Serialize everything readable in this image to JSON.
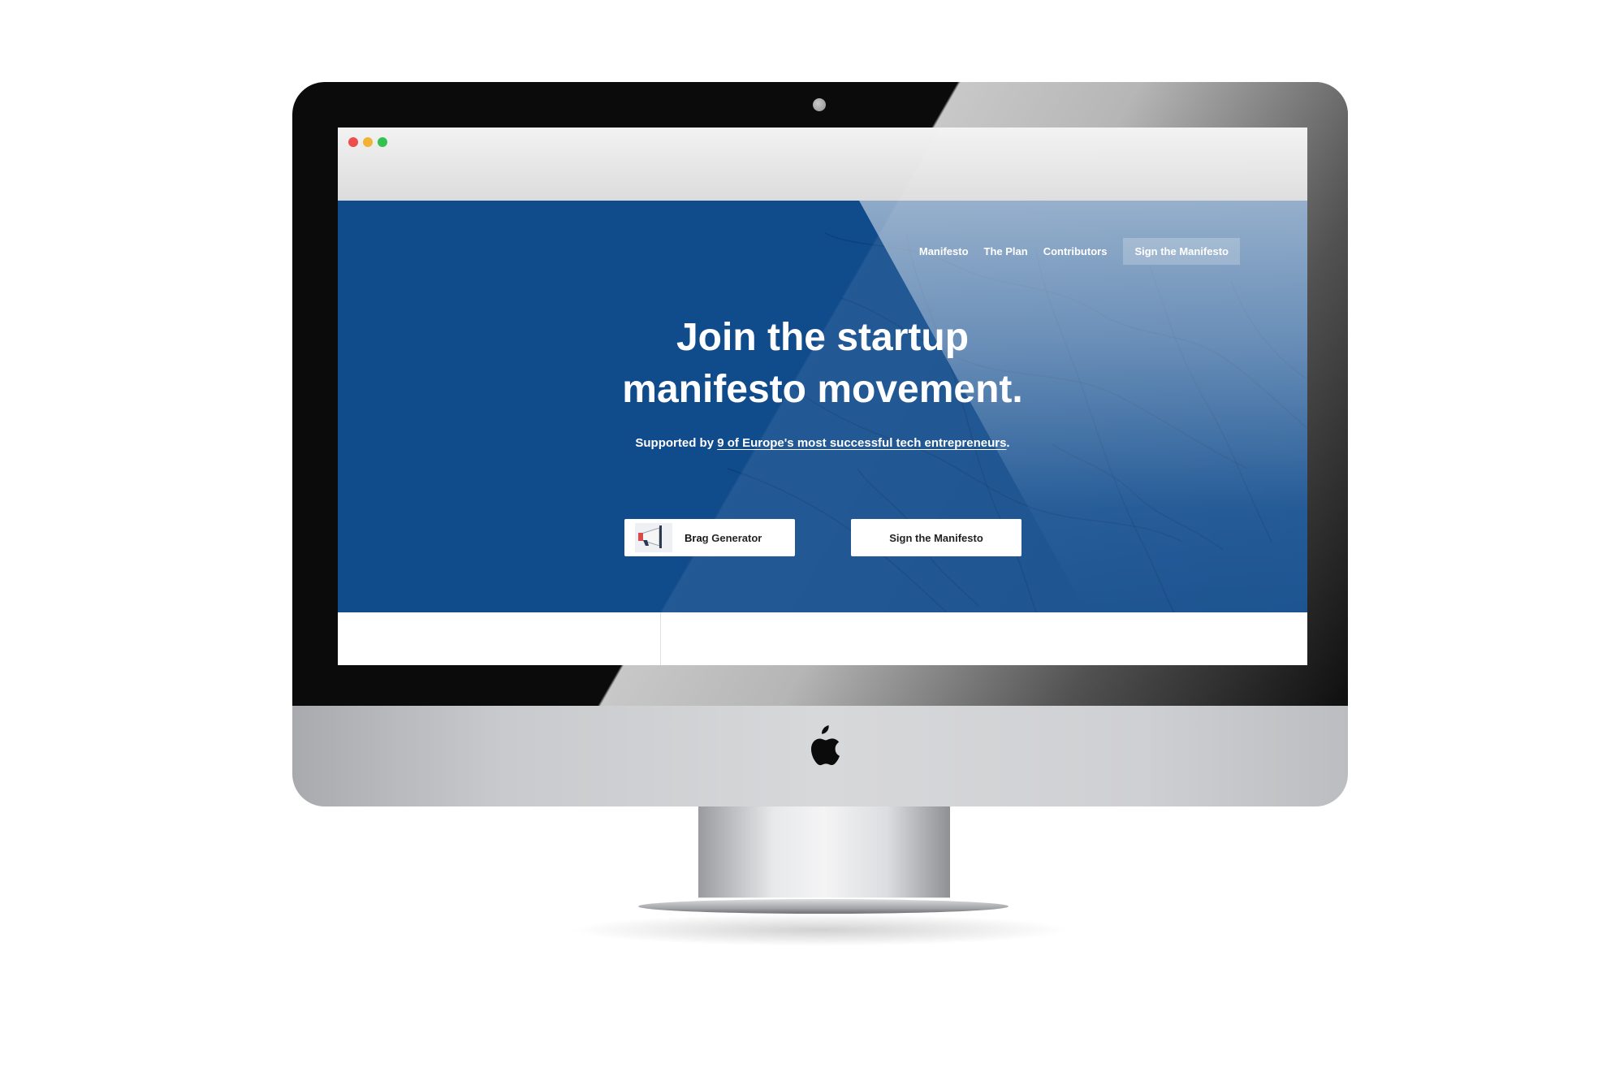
{
  "window": {
    "traffic_lights": [
      "close",
      "minimize",
      "zoom"
    ]
  },
  "nav": {
    "items": [
      {
        "label": "Manifesto"
      },
      {
        "label": "The Plan"
      },
      {
        "label": "Contributors"
      }
    ],
    "cta_label": "Sign the Manifesto"
  },
  "hero": {
    "title_line_1": "Join the startup",
    "title_line_2": "manifesto movement.",
    "subtitle_prefix": "Supported by ",
    "subtitle_link": "9 of Europe's most successful tech entrepreneurs",
    "subtitle_suffix": "."
  },
  "buttons": {
    "brag_label": "Brag Generator",
    "brag_icon": "megaphone-icon",
    "sign_label": "Sign the Manifesto"
  },
  "colors": {
    "hero_blue": "#104b8b",
    "button_bg": "#ffffff",
    "close": "#ee4d4d",
    "minimize": "#f2b233",
    "zoom": "#33c24d"
  },
  "device": {
    "brand_icon": "apple-logo-icon"
  }
}
